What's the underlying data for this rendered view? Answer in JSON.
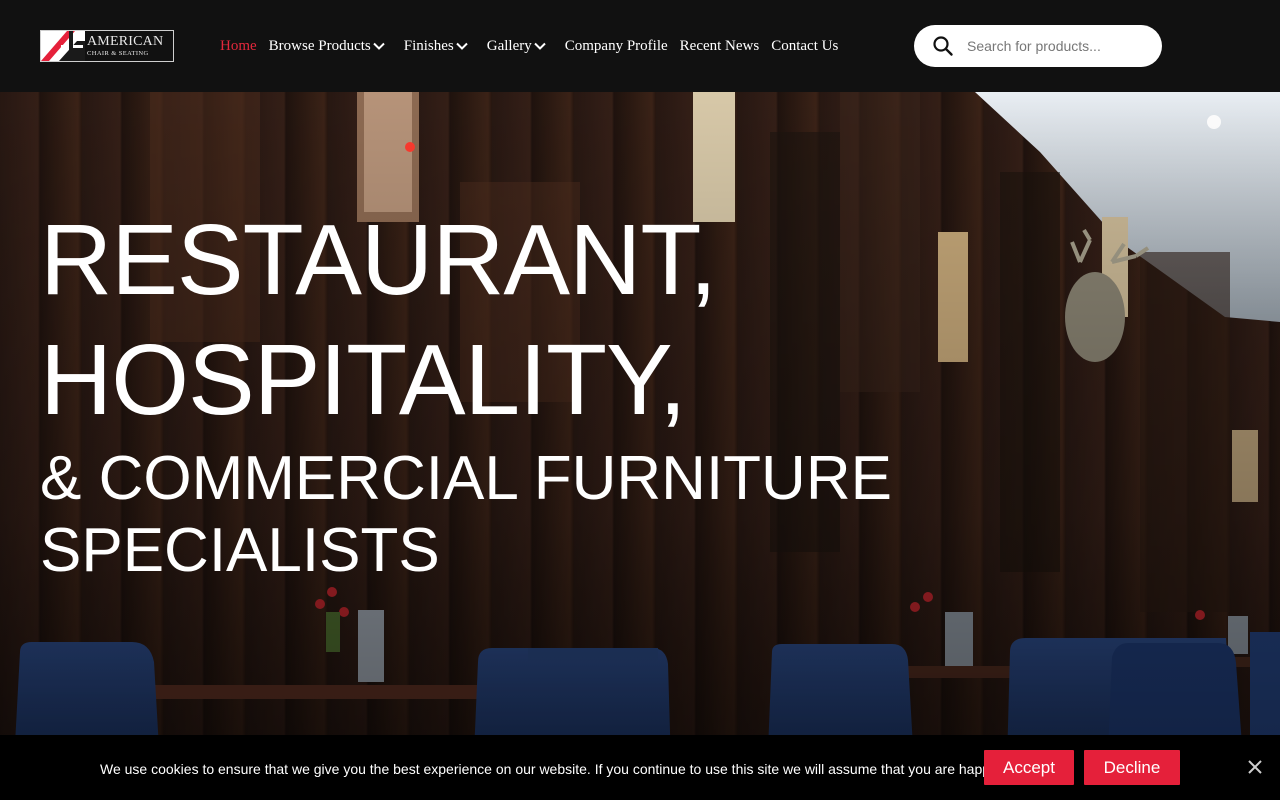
{
  "header": {
    "logo": {
      "line1": "AMERICAN",
      "line2": "CHAIR & SEATING"
    },
    "nav": [
      {
        "label": "Home",
        "active": true,
        "dropdown": false
      },
      {
        "label": "Browse Products",
        "active": false,
        "dropdown": true
      },
      {
        "label": "Finishes",
        "active": false,
        "dropdown": true
      },
      {
        "label": "Gallery",
        "active": false,
        "dropdown": true
      },
      {
        "label": "Company Profile",
        "active": false,
        "dropdown": false
      },
      {
        "label": "Recent News",
        "active": false,
        "dropdown": false
      },
      {
        "label": "Contact Us",
        "active": false,
        "dropdown": false
      }
    ],
    "search": {
      "placeholder": "Search for products...",
      "value": "",
      "icon": "search-icon"
    }
  },
  "hero": {
    "line1": "RESTAURANT,",
    "line2": "HOSPITALITY,",
    "line3": "& COMMERCIAL FURNITURE",
    "line4": "SPECIALISTS"
  },
  "cookie": {
    "text": "We use cookies to ensure that we give you the best experience on our website. If you continue to use this site we will assume that you are happy with it.",
    "accept_label": "Accept",
    "decline_label": "Decline",
    "close_icon": "close-icon"
  },
  "colors": {
    "accent": "#e5203a",
    "nav_active": "#e3283c",
    "header_bg": "#111111",
    "cookie_bg": "#000000"
  }
}
